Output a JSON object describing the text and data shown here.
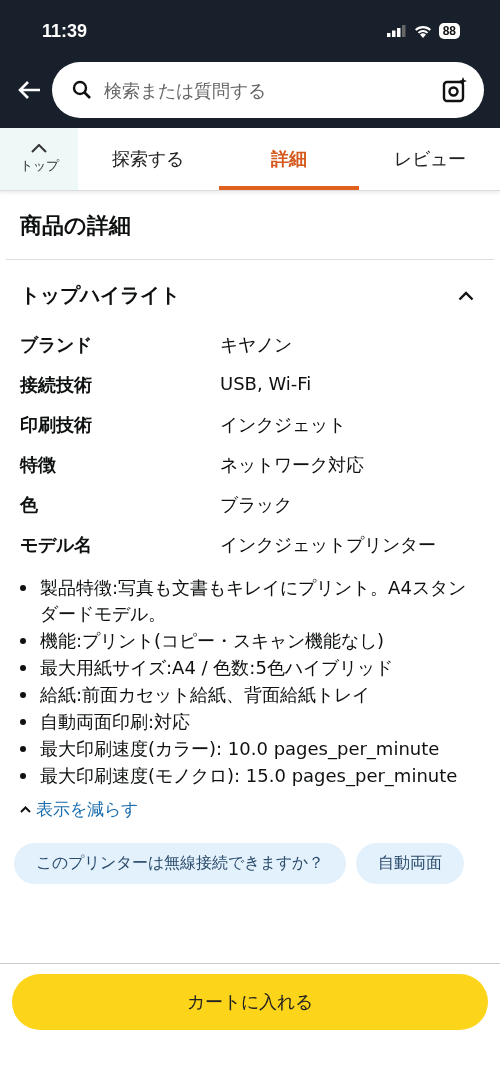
{
  "status_bar": {
    "time": "11:39",
    "battery": "88"
  },
  "search": {
    "placeholder": "検索または質問する"
  },
  "tabs": [
    {
      "label": "探索する",
      "selected": false
    },
    {
      "label": "詳細",
      "selected": true
    },
    {
      "label": "レビュー",
      "selected": false
    }
  ],
  "top_button": {
    "label": "トップ"
  },
  "section_title": "商品の詳細",
  "highlights": {
    "title": "トップハイライト",
    "expanded": true,
    "specs": [
      {
        "name": "ブランド",
        "value": "キヤノン"
      },
      {
        "name": "接続技術",
        "value": "USB, Wi-Fi"
      },
      {
        "name": "印刷技術",
        "value": "インクジェット"
      },
      {
        "name": "特徴",
        "value": "ネットワーク対応"
      },
      {
        "name": "色",
        "value": "ブラック"
      },
      {
        "name": "モデル名",
        "value": "インクジェットプリンター"
      }
    ],
    "bullets": [
      "製品特徴:写真も文書もキレイにプリント。A4スタンダードモデル。",
      "機能:プリント(コピー・スキャン機能なし)",
      "最大用紙サイズ:A4 / 色数:5色ハイブリッド",
      "給紙:前面カセット給紙、背面給紙トレイ",
      "自動両面印刷:対応",
      "最大印刷速度(カラー): 10.0 pages_per_minute",
      "最大印刷速度(モノクロ): 15.0 pages_per_minute"
    ],
    "toggle": "表示を減らす"
  },
  "question_chips": [
    "このプリンターは無線接続できますか？",
    "自動両面"
  ],
  "cart_button": "カートに入れる"
}
